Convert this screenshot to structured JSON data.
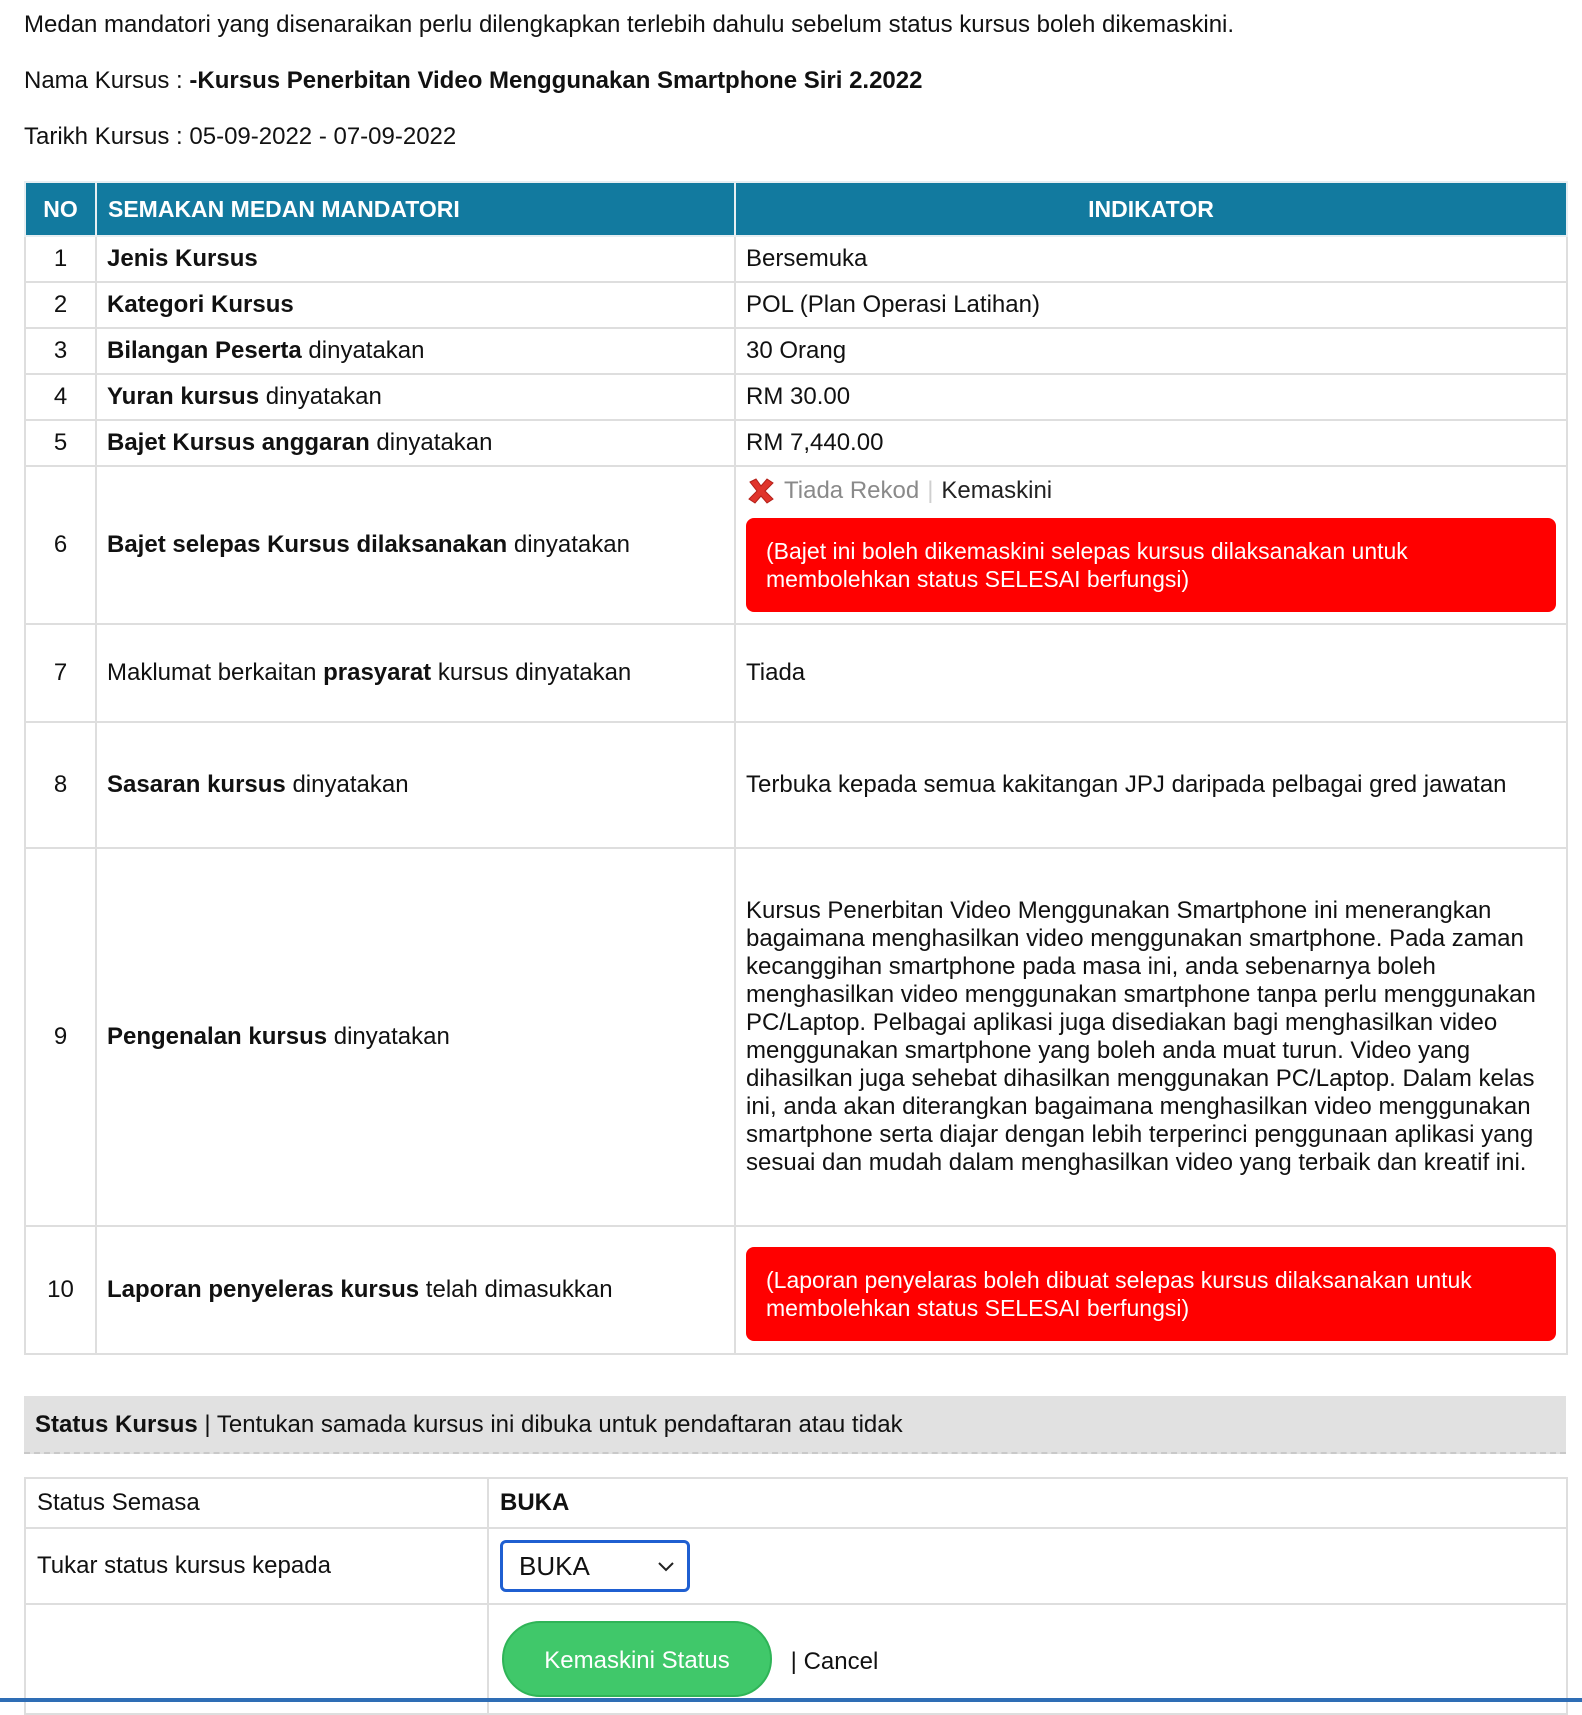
{
  "intro": "Medan mandatori yang disenaraikan perlu dilengkapkan terlebih dahulu sebelum status kursus boleh dikemaskini.",
  "course": {
    "name_label": "Nama Kursus : ",
    "name": "-Kursus Penerbitan Video Menggunakan Smartphone Siri 2.2022",
    "date_label": "Tarikh Kursus : ",
    "date": "05-09-2022 - 07-09-2022"
  },
  "table": {
    "headers": {
      "no": "NO",
      "check": "SEMAKAN MEDAN MANDATORI",
      "indicator": "INDIKATOR"
    },
    "rows": [
      {
        "no": "1",
        "bold": "Jenis Kursus",
        "suffix": "",
        "indicator": "Bersemuka"
      },
      {
        "no": "2",
        "bold": "Kategori Kursus",
        "suffix": "",
        "indicator": "POL (Plan Operasi Latihan)"
      },
      {
        "no": "3",
        "bold": "Bilangan Peserta",
        "suffix": " dinyatakan",
        "indicator": "30 Orang"
      },
      {
        "no": "4",
        "bold": "Yuran kursus",
        "suffix": " dinyatakan",
        "indicator": "RM 30.00"
      },
      {
        "no": "5",
        "bold": "Bajet Kursus anggaran",
        "suffix": " dinyatakan",
        "indicator": "RM 7,440.00"
      },
      {
        "no": "6",
        "bold": "Bajet selepas Kursus dilaksanakan",
        "suffix": " dinyatakan",
        "no_record": "Tiada Rekod",
        "update_link": "Kemaskini",
        "alert": "(Bajet ini boleh dikemaskini selepas kursus dilaksanakan untuk membolehkan status SELESAI berfungsi)"
      },
      {
        "no": "7",
        "prefix": "Maklumat berkaitan ",
        "bold": "prasyarat",
        "suffix": " kursus dinyatakan",
        "indicator": "Tiada"
      },
      {
        "no": "8",
        "bold": "Sasaran kursus",
        "suffix": " dinyatakan",
        "indicator": "Terbuka kepada semua kakitangan JPJ daripada pelbagai gred jawatan"
      },
      {
        "no": "9",
        "bold": "Pengenalan kursus",
        "suffix": " dinyatakan",
        "indicator": "Kursus Penerbitan Video Menggunakan Smartphone ini menerangkan bagaimana menghasilkan video menggunakan smartphone. Pada zaman kecanggihan smartphone pada masa ini, anda sebenarnya boleh menghasilkan video menggunakan smartphone tanpa perlu menggunakan PC/Laptop. Pelbagai aplikasi juga disediakan bagi menghasilkan video menggunakan smartphone yang boleh anda muat turun. Video yang dihasilkan juga sehebat dihasilkan menggunakan PC/Laptop. Dalam kelas ini, anda akan diterangkan bagaimana menghasilkan video menggunakan smartphone serta diajar dengan lebih terperinci penggunaan aplikasi yang sesuai dan mudah dalam menghasilkan video yang terbaik dan kreatif ini."
      },
      {
        "no": "10",
        "bold": "Laporan penyeleras kursus",
        "suffix": " telah dimasukkan",
        "alert": "(Laporan penyelaras boleh dibuat selepas kursus dilaksanakan untuk membolehkan status SELESAI berfungsi)"
      }
    ]
  },
  "status_section": {
    "title": "Status Kursus",
    "desc": " | Tentukan samada kursus ini dibuka untuk pendaftaran atau tidak",
    "current_label": "Status Semasa",
    "current_value": "BUKA",
    "change_label": "Tukar status kursus kepada",
    "selected": "BUKA",
    "update_button": "Kemaskini Status",
    "cancel_sep": "| ",
    "cancel": "Cancel"
  },
  "colors": {
    "header": "#127a9f",
    "alert": "#ff0000",
    "button": "#40c86a",
    "select_border": "#1f5fd1"
  },
  "icons": {
    "no_record": "red-x-icon",
    "select": "chevron-down-icon"
  }
}
